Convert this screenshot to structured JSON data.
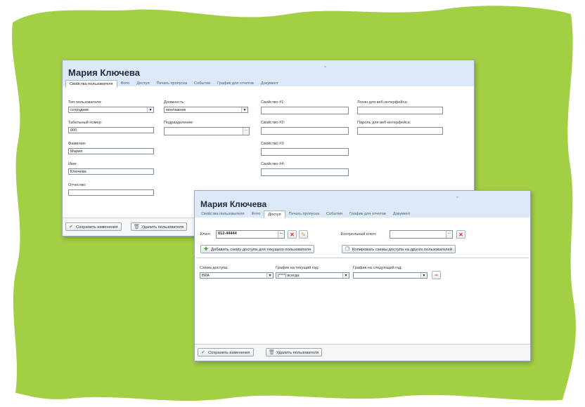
{
  "colors": {
    "blob": "#a3cf45",
    "header": "#dce9f6",
    "delete": "#d9342b",
    "save_check": "#4caf2a"
  },
  "window1": {
    "title": "Мария Ключева",
    "tabs": [
      "Свойства пользователя",
      "Фото",
      "Доступ",
      "Печать пропуска",
      "События",
      "График для отчетов",
      "Документ"
    ],
    "active_tab": "Свойства пользователя",
    "fields": {
      "user_type": {
        "label": "Тип пользователя:",
        "value": "сотрудник"
      },
      "position": {
        "label": "Должность:",
        "value": "монтажник"
      },
      "prop1": {
        "label": "Свойство #1:",
        "value": ""
      },
      "web_login": {
        "label": "Логин для веб-интерфейса:",
        "value": ""
      },
      "tab_number": {
        "label": "Табельный номер:",
        "value": "000"
      },
      "department": {
        "label": "Подразделение:",
        "value": ""
      },
      "prop2": {
        "label": "Свойство #2:",
        "value": ""
      },
      "web_password": {
        "label": "Пароль для веб-интерфейса:",
        "value": ""
      },
      "last_name": {
        "label": "Фамилия:",
        "value": "Мария"
      },
      "prop3": {
        "label": "Свойство #3:",
        "value": ""
      },
      "first_name": {
        "label": "Имя:",
        "value": "Ключева"
      },
      "prop4": {
        "label": "Свойство #4:",
        "value": ""
      },
      "patronymic": {
        "label": "Отчество:",
        "value": ""
      }
    },
    "footer": {
      "save_label": "Сохранить изменения",
      "delete_label": "Удалить пользователя"
    }
  },
  "window2": {
    "title": "Мария Ключева",
    "tabs": [
      "Свойства пользователя",
      "Фото",
      "Доступ",
      "Печать пропуска",
      "События",
      "График для отчетов",
      "Документ"
    ],
    "active_tab": "Доступ",
    "key": {
      "label": "Ключ:",
      "value": "012-44444"
    },
    "control_key": {
      "label": "Контрольный ключ:",
      "value": ""
    },
    "add_scheme_label": "Добавить схему доступа для текущего пользователя",
    "copy_scheme_label": "Копировать схемы доступа на других пользователей",
    "scheme": {
      "label": "Схема доступа:",
      "value": "ВРА"
    },
    "schedule_current": {
      "label": "График на текущий год:",
      "value": "[****] всегда"
    },
    "schedule_next": {
      "label": "График на следующий год:",
      "value": ""
    },
    "footer": {
      "save_label": "Сохранить изменения",
      "delete_label": "Удалить пользователя"
    }
  }
}
